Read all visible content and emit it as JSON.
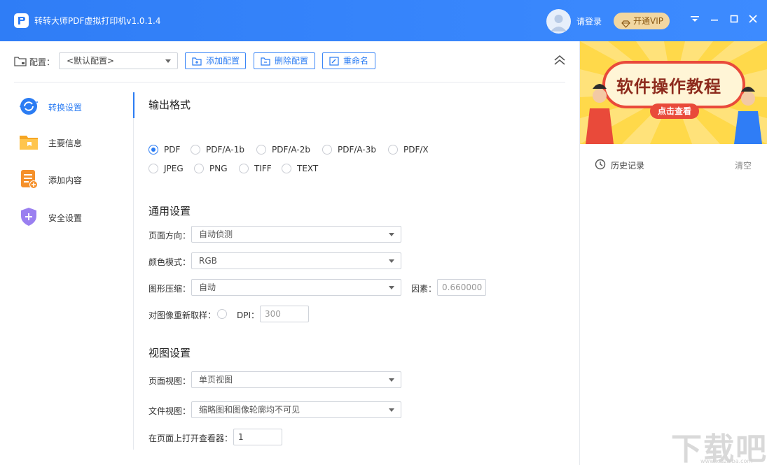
{
  "window": {
    "title": "转转大师PDF虚拟打印机v1.0.1.4",
    "login_label": "请登录",
    "vip_label": "开通VIP"
  },
  "config_bar": {
    "label": "配置：",
    "selected": "<默认配置>",
    "add_label": "添加配置",
    "delete_label": "删除配置",
    "rename_label": "重命名"
  },
  "sidebar": {
    "items": [
      {
        "label": "转换设置",
        "icon": "convert-settings-icon",
        "active": true
      },
      {
        "label": "主要信息",
        "icon": "folder-info-icon",
        "active": false
      },
      {
        "label": "添加内容",
        "icon": "add-content-icon",
        "active": false
      },
      {
        "label": "安全设置",
        "icon": "security-shield-icon",
        "active": false
      }
    ]
  },
  "output_format": {
    "title": "输出格式",
    "options": [
      {
        "label": "PDF",
        "checked": true
      },
      {
        "label": "PDF/A-1b",
        "checked": false
      },
      {
        "label": "PDF/A-2b",
        "checked": false
      },
      {
        "label": "PDF/A-3b",
        "checked": false
      },
      {
        "label": "PDF/X",
        "checked": false
      },
      {
        "label": "JPEG",
        "checked": false
      },
      {
        "label": "PNG",
        "checked": false
      },
      {
        "label": "TIFF",
        "checked": false
      },
      {
        "label": "TEXT",
        "checked": false
      }
    ]
  },
  "general": {
    "title": "通用设置",
    "orientation_label": "页面方向：",
    "orientation_value": "自动侦测",
    "color_label": "颜色模式：",
    "color_value": "RGB",
    "compress_label": "图形压缩：",
    "compress_value": "自动",
    "factor_label": "因素：",
    "factor_value": "0.660000",
    "resample_label": "对图像重新取样：",
    "dpi_label": "DPI：",
    "dpi_value": "300"
  },
  "view": {
    "title": "视图设置",
    "page_view_label": "页面视图：",
    "page_view_value": "单页视图",
    "file_view_label": "文件视图：",
    "file_view_value": "缩略图和图像轮廓均不可见",
    "open_viewer_label": "在页面上打开查看器：",
    "open_viewer_value": "1"
  },
  "right_panel": {
    "banner_title": "软件操作教程",
    "banner_sub": "点击查看",
    "history_label": "历史记录",
    "clear_label": "清空"
  },
  "watermark": {
    "text": "下载吧",
    "url": "www.xiazaiba.com"
  },
  "colors": {
    "accent": "#2b7cf3",
    "titlebar": "#3486f8",
    "vip_bg": "#f2d7a1",
    "banner_bg": "#ffd94a"
  }
}
